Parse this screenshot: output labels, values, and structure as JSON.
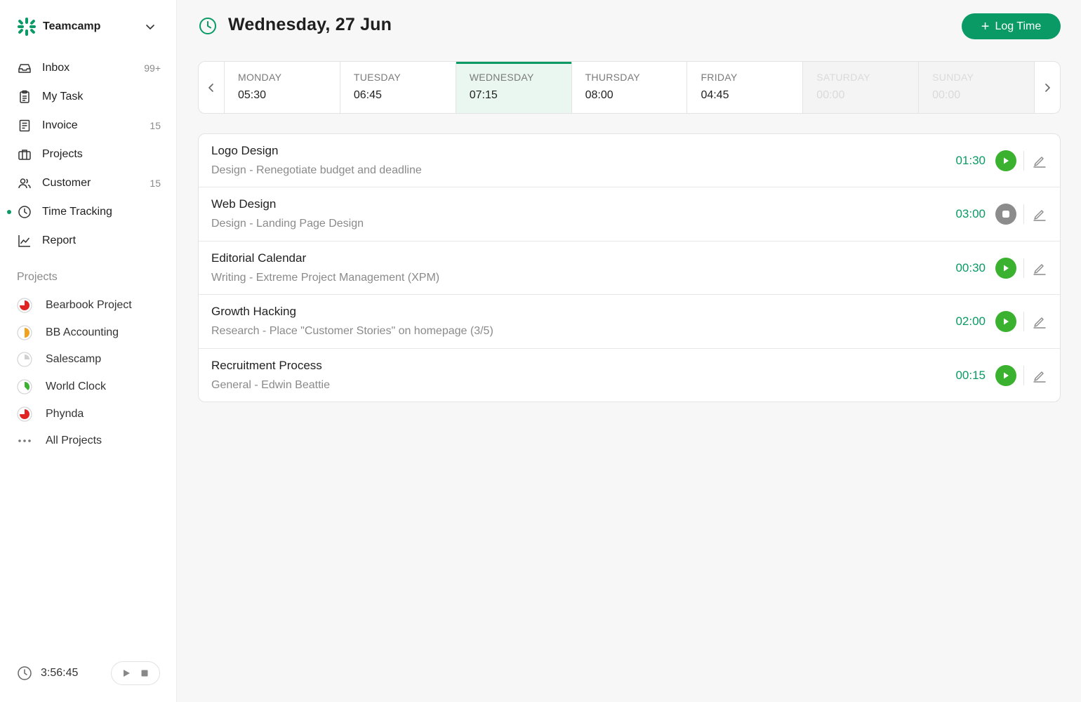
{
  "brand": {
    "name": "Teamcamp",
    "accent": "#0a9a65"
  },
  "nav": [
    {
      "label": "Inbox",
      "icon": "inbox-icon",
      "count": "99+"
    },
    {
      "label": "My Task",
      "icon": "clipboard-icon",
      "count": ""
    },
    {
      "label": "Invoice",
      "icon": "invoice-icon",
      "count": "15"
    },
    {
      "label": "Projects",
      "icon": "briefcase-icon",
      "count": ""
    },
    {
      "label": "Customer",
      "icon": "users-icon",
      "count": "15"
    },
    {
      "label": "Time Tracking",
      "icon": "clock-icon",
      "count": "",
      "active": true
    },
    {
      "label": "Report",
      "icon": "chart-icon",
      "count": ""
    }
  ],
  "projects_section": {
    "title": "Projects",
    "items": [
      {
        "label": "Bearbook Project",
        "icon": "progress-pie-icon",
        "color": "#e02424",
        "progress": 0.75
      },
      {
        "label": "BB Accounting",
        "icon": "progress-pie-icon",
        "color": "#f0a11f",
        "progress": 0.5
      },
      {
        "label": "Salescamp",
        "icon": "progress-pie-icon",
        "color": "#cfcfcf",
        "progress": 0.25
      },
      {
        "label": "World Clock",
        "icon": "progress-pie-icon",
        "color": "#3bb22f",
        "progress": 0.375
      },
      {
        "label": "Phynda",
        "icon": "progress-pie-icon",
        "color": "#e02424",
        "progress": 0.75
      }
    ],
    "all_label": "All Projects"
  },
  "timer": {
    "time": "3:56:45"
  },
  "header": {
    "title": "Wednesday, 27 Jun",
    "log_button": "Log Time"
  },
  "week": [
    {
      "day": "MONDAY",
      "time": "05:30",
      "state": "normal"
    },
    {
      "day": "TUESDAY",
      "time": "06:45",
      "state": "normal"
    },
    {
      "day": "WEDNESDAY",
      "time": "07:15",
      "state": "active"
    },
    {
      "day": "THURSDAY",
      "time": "08:00",
      "state": "normal"
    },
    {
      "day": "FRIDAY",
      "time": "04:45",
      "state": "normal"
    },
    {
      "day": "SATURDAY",
      "time": "00:00",
      "state": "weekend"
    },
    {
      "day": "SUNDAY",
      "time": "00:00",
      "state": "weekend"
    }
  ],
  "tasks": [
    {
      "title": "Logo Design",
      "subtitle": "Design - Renegotiate budget and deadline",
      "duration": "01:30",
      "control": "play"
    },
    {
      "title": "Web Design",
      "subtitle": "Design - Landing Page Design",
      "duration": "03:00",
      "control": "stop"
    },
    {
      "title": "Editorial Calendar",
      "subtitle": "Writing - Extreme Project Management (XPM)",
      "duration": "00:30",
      "control": "play"
    },
    {
      "title": "Growth Hacking",
      "subtitle": "Research - Place \"Customer Stories\" on homepage (3/5)",
      "duration": "02:00",
      "control": "play"
    },
    {
      "title": "Recruitment Process",
      "subtitle": "General - Edwin Beattie",
      "duration": "00:15",
      "control": "play"
    }
  ]
}
